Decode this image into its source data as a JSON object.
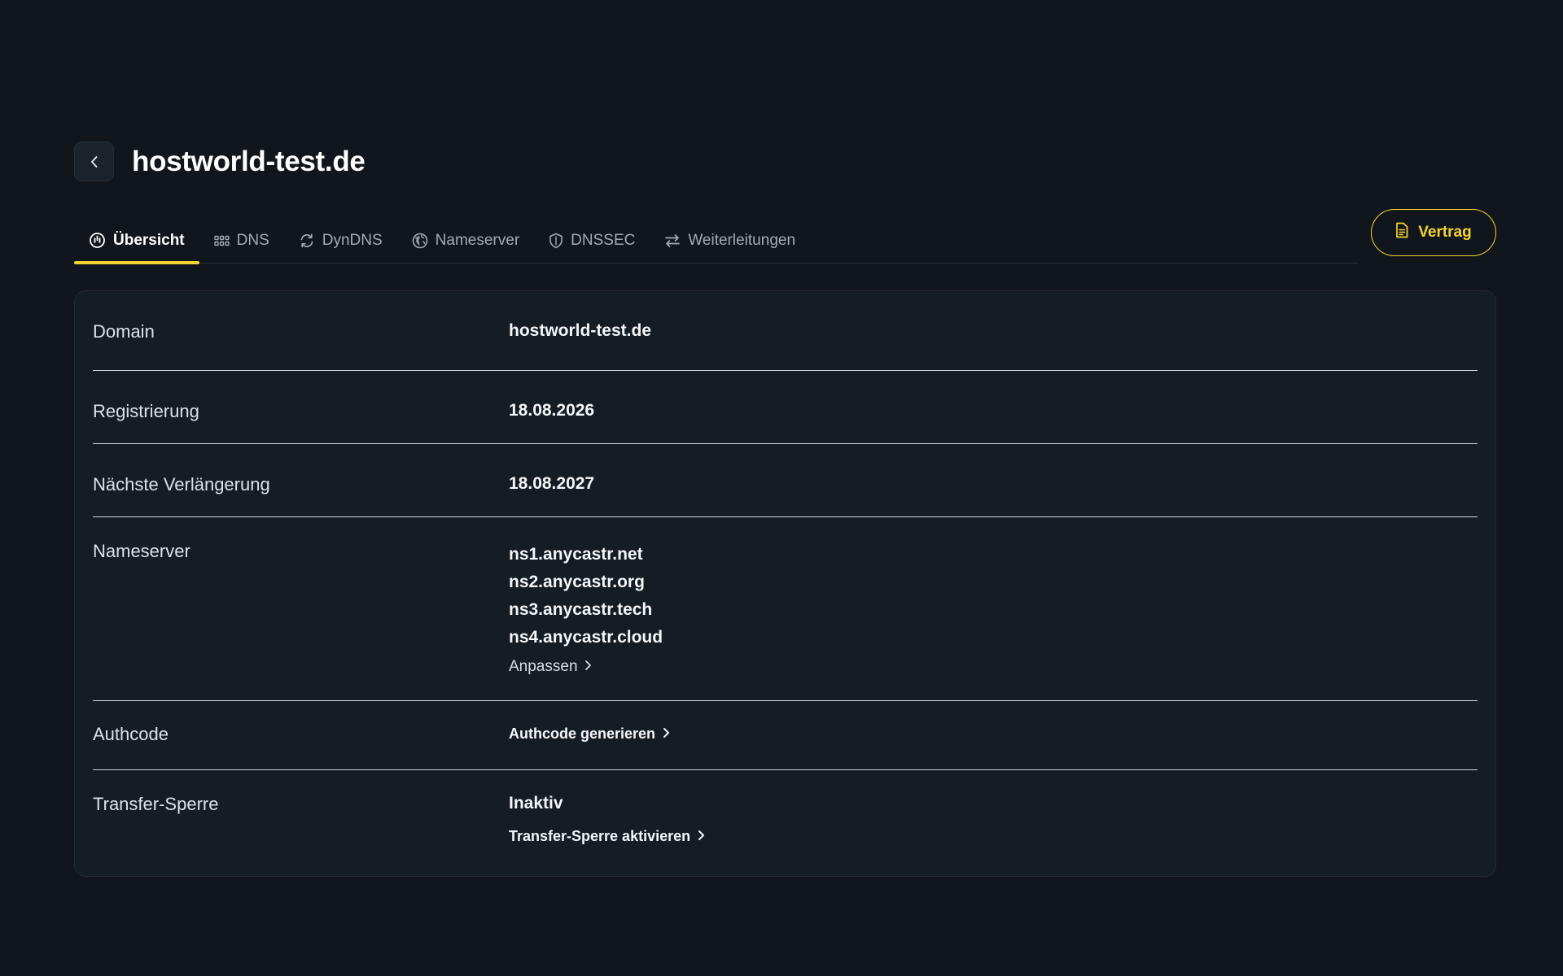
{
  "header": {
    "back_icon": "chevron-left-icon",
    "title": "hostworld-test.de"
  },
  "tabs": [
    {
      "label": "Übersicht",
      "icon": "info-clock-icon",
      "active": true
    },
    {
      "label": "DNS",
      "icon": "grid-dots-icon",
      "active": false
    },
    {
      "label": "DynDNS",
      "icon": "refresh-icon",
      "active": false
    },
    {
      "label": "Nameserver",
      "icon": "globe-icon",
      "active": false
    },
    {
      "label": "DNSSEC",
      "icon": "shield-icon",
      "active": false
    },
    {
      "label": "Weiterleitungen",
      "icon": "arrows-swap-icon",
      "active": false
    }
  ],
  "contract_button": {
    "label": "Vertrag",
    "icon": "document-icon"
  },
  "details": {
    "domain": {
      "label": "Domain",
      "value": "hostworld-test.de"
    },
    "registration": {
      "label": "Registrierung",
      "value": "18.08.2026"
    },
    "next_renewal": {
      "label": "Nächste Verlängerung",
      "value": "18.08.2027"
    },
    "nameserver": {
      "label": "Nameserver",
      "values": [
        "ns1.anycastr.net",
        "ns2.anycastr.org",
        "ns3.anycastr.tech",
        "ns4.anycastr.cloud"
      ],
      "action": "Anpassen"
    },
    "authcode": {
      "label": "Authcode",
      "action": "Authcode generieren"
    },
    "transfer_lock": {
      "label": "Transfer-Sperre",
      "status": "Inaktiv",
      "action": "Transfer-Sperre aktivieren"
    }
  },
  "colors": {
    "background": "#11161d",
    "card": "#141c24",
    "accent": "#f5d432",
    "text": "#f4f6f8",
    "muted": "#a2abb4"
  }
}
